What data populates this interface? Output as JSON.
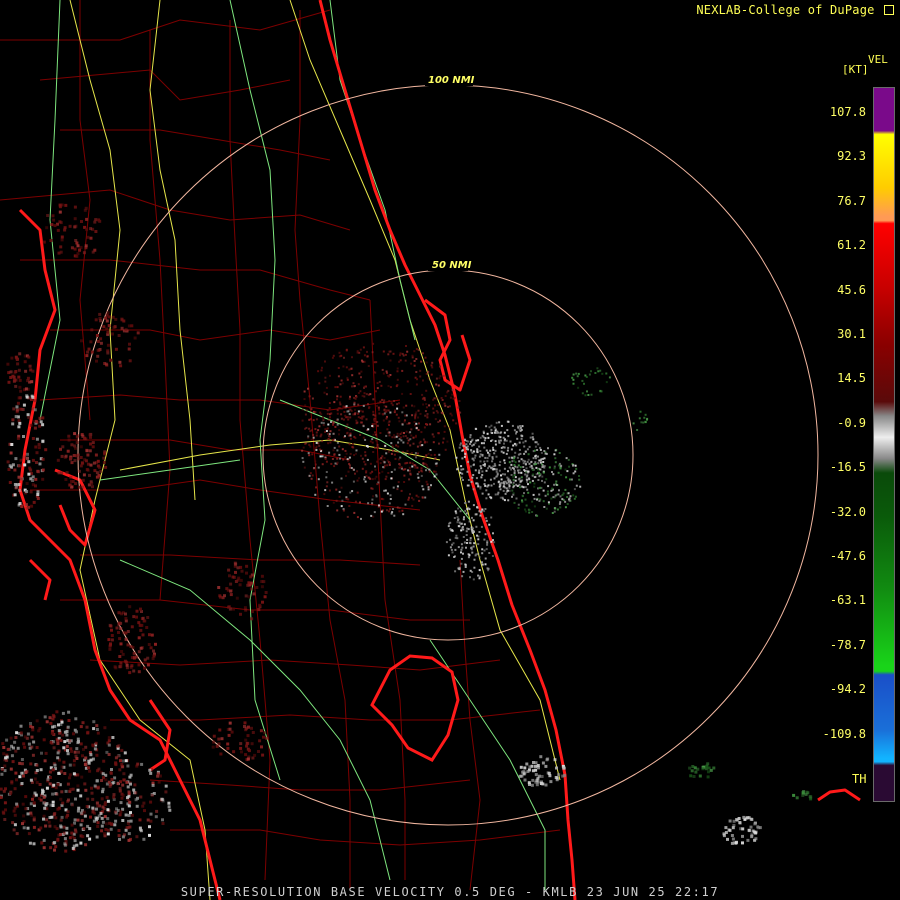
{
  "header": {
    "credit": "NEXLAB-College of DuPage",
    "credit_icon": "arrow-icon"
  },
  "footer": {
    "caption": "SUPER-RESOLUTION BASE VELOCITY 0.5 DEG - KMLB 23 JUN 25 22:17"
  },
  "rings": [
    {
      "label": "50 NMI"
    },
    {
      "label": "100 NMI"
    }
  ],
  "legend": {
    "product": "VEL",
    "unit": "[KT]",
    "th_label": "TH",
    "ticks": [
      "107.8",
      "92.3",
      "76.7",
      "61.2",
      "45.6",
      "30.1",
      "14.5",
      "-0.9",
      "-16.5",
      "-32.0",
      "-47.6",
      "-63.1",
      "-78.7",
      "-94.2",
      "-109.8"
    ],
    "colors": {
      "purple": "#7a0a8a",
      "yellow": "#ffff00",
      "orange": "#ff9a55",
      "red": "#ff0000",
      "dark_red": "#5a0a0a",
      "gray": "#bfbfbf",
      "dark_green": "#0a4a0a",
      "green": "#19d419",
      "blue": "#1a4fc8",
      "cyan": "#12b4ff"
    }
  }
}
